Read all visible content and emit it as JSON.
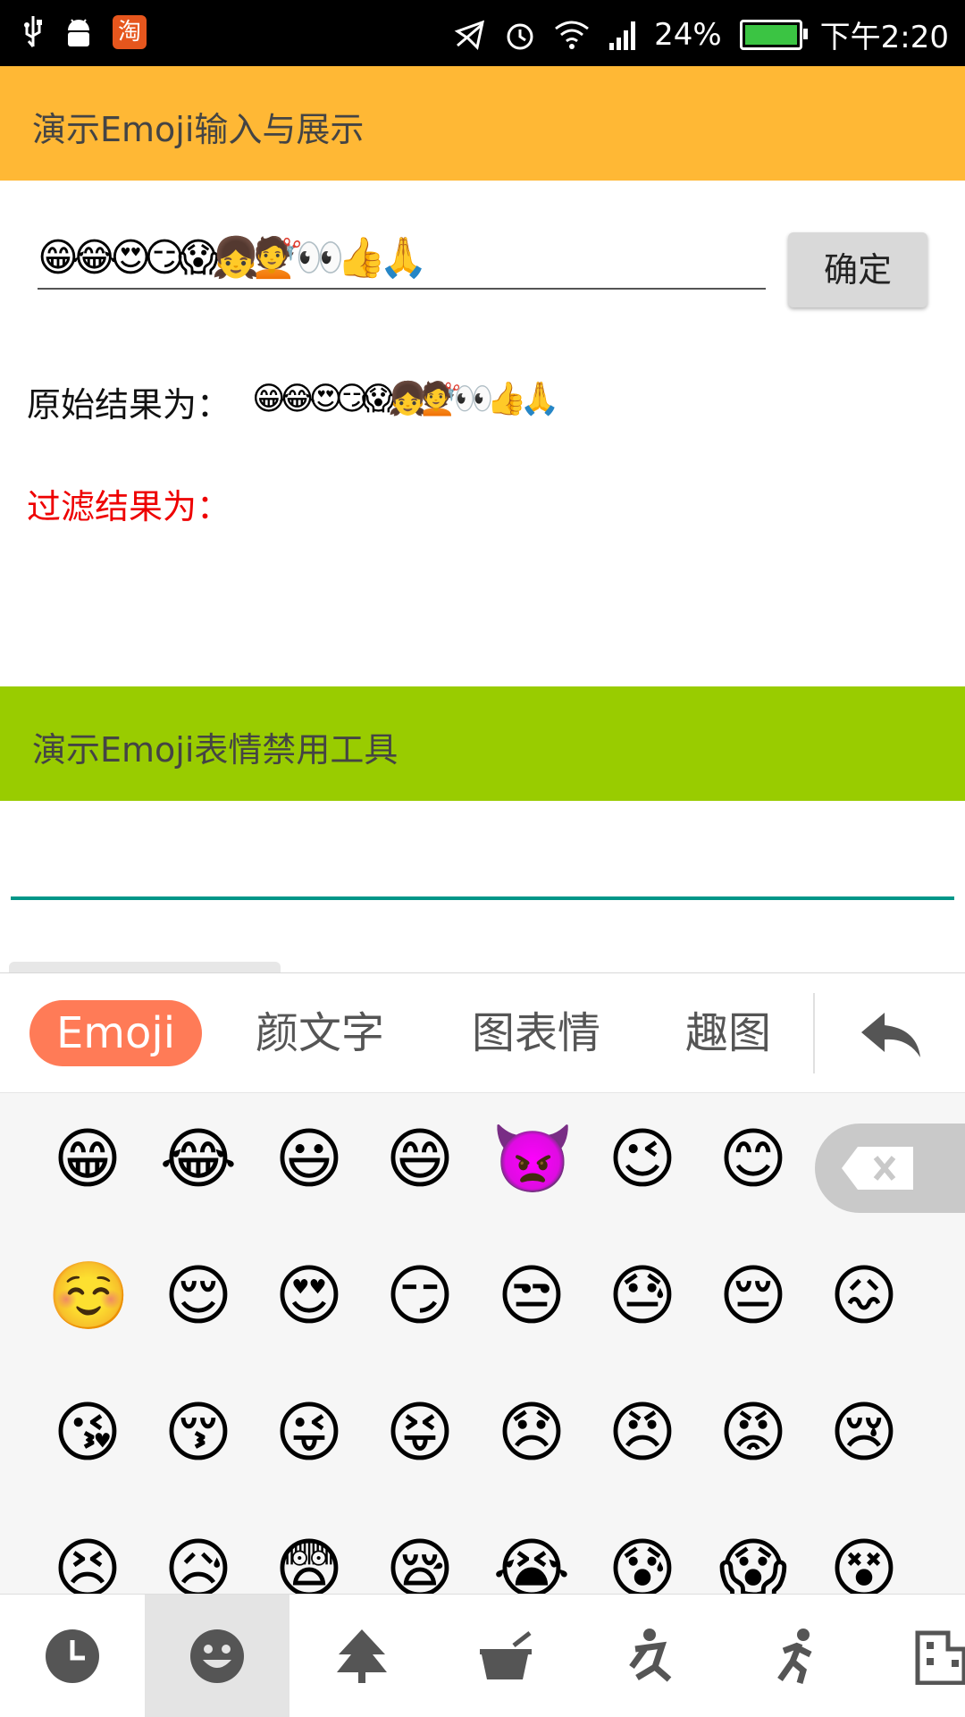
{
  "status_bar": {
    "battery_percent": "24%",
    "battery_level": 0.24,
    "time": "下午2:20",
    "icons": [
      "usb-icon",
      "android-icon",
      "taobao-icon",
      "mute-icon",
      "alarm-icon",
      "wifi-icon",
      "signal-icon",
      "battery-icon"
    ],
    "taobao_glyph": "淘"
  },
  "header1": {
    "title": "演示Emoji输入与展示"
  },
  "input_row": {
    "value": "😁😂😍😏😱👧💇👀👍🙏",
    "confirm_label": "确定"
  },
  "raw_result": {
    "label": "原始结果为：",
    "value": "😁😂😍😏😱👧💇👀👍🙏"
  },
  "filter_result": {
    "label": "过滤结果为：",
    "value": ""
  },
  "header2": {
    "title": "演示Emoji表情禁用工具"
  },
  "keyboard": {
    "tabs": [
      "Emoji",
      "颜文字",
      "图表情",
      "趣图"
    ],
    "active_tab": 0,
    "grid_rows": [
      [
        "😁",
        "😂",
        "😃",
        "😄",
        "👿",
        "😉",
        "😊"
      ],
      [
        "☺️",
        "😌",
        "😍",
        "😏",
        "😒",
        "😓",
        "😔",
        "😖"
      ],
      [
        "😘",
        "😚",
        "😜",
        "😝",
        "😞",
        "😠",
        "😡",
        "😢"
      ],
      [
        "😣",
        "😥",
        "😨",
        "😪",
        "😭",
        "😰",
        "😱",
        "😵"
      ]
    ],
    "categories": [
      "clock-icon",
      "smiley-icon",
      "tree-icon",
      "coffee-icon",
      "activity-icon",
      "running-icon",
      "building-icon"
    ],
    "active_category": 1,
    "accent_color": "#ff7b57"
  }
}
